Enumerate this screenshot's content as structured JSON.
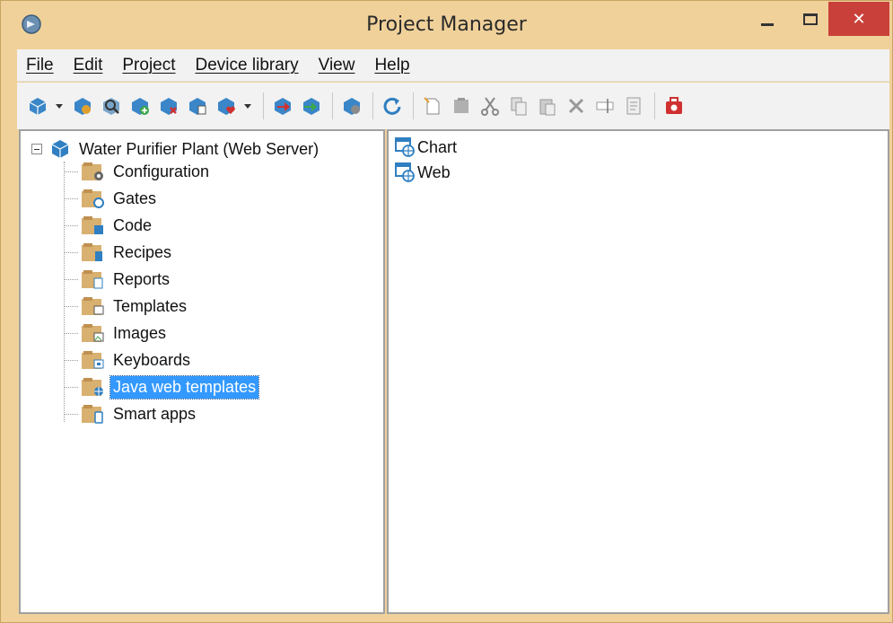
{
  "window": {
    "title": "Project Manager"
  },
  "menu": [
    "File",
    "Edit",
    "Project",
    "Device library",
    "View",
    "Help"
  ],
  "toolbar": {
    "buttons": [
      "project-icon",
      "project-dropdown",
      "build-icon",
      "search-icon",
      "add-device-icon",
      "remove-device-icon",
      "device-properties-icon",
      "device-favorite-icon",
      "device-dropdown",
      "upload-icon",
      "download-icon",
      "deploy-icon",
      "refresh-icon",
      "new-icon",
      "folder-icon",
      "cut-icon",
      "copy-icon",
      "paste-icon",
      "delete-icon",
      "rename-icon",
      "properties-icon",
      "toolbox-icon"
    ]
  },
  "tree": {
    "root_label": "Water Purifier Plant (Web Server)",
    "children": [
      {
        "label": "Configuration",
        "icon": "configuration-folder-icon"
      },
      {
        "label": "Gates",
        "icon": "gates-folder-icon"
      },
      {
        "label": "Code",
        "icon": "code-folder-icon"
      },
      {
        "label": "Recipes",
        "icon": "recipes-folder-icon"
      },
      {
        "label": "Reports",
        "icon": "reports-folder-icon"
      },
      {
        "label": "Templates",
        "icon": "templates-folder-icon"
      },
      {
        "label": "Images",
        "icon": "images-folder-icon"
      },
      {
        "label": "Keyboards",
        "icon": "keyboards-folder-icon"
      },
      {
        "label": "Java web templates",
        "icon": "java-web-templates-folder-icon",
        "selected": true
      },
      {
        "label": "Smart apps",
        "icon": "smart-apps-folder-icon"
      }
    ]
  },
  "list": {
    "items": [
      {
        "label": "Chart",
        "icon": "web-template-icon"
      },
      {
        "label": "Web",
        "icon": "web-template-icon"
      }
    ]
  },
  "colors": {
    "frame": "#f0d19a",
    "close": "#c9403a",
    "selection": "#3399ff",
    "accent_blue": "#2f7fc1"
  }
}
